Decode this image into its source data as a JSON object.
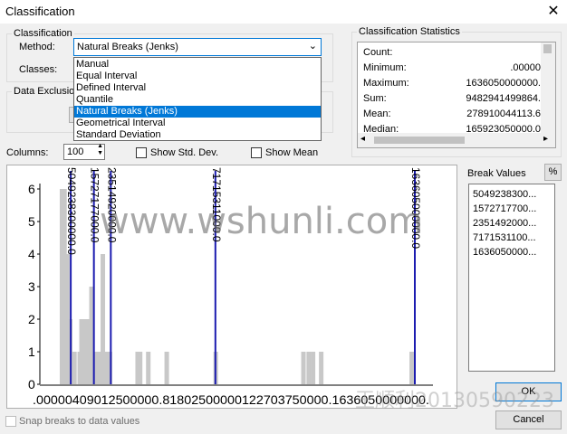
{
  "window": {
    "title": "Classification"
  },
  "classification": {
    "group_label": "Classification",
    "method_label": "Method:",
    "method_value": "Natural Breaks (Jenks)",
    "classes_label": "Classes:"
  },
  "method_options": [
    "Manual",
    "Equal Interval",
    "Defined Interval",
    "Quantile",
    "Natural Breaks (Jenks)",
    "Geometrical Interval",
    "Standard Deviation"
  ],
  "data_exclusion": {
    "label": "Data Exclusion"
  },
  "stats": {
    "title": "Classification Statistics",
    "rows": [
      {
        "label": "Count:",
        "value": ""
      },
      {
        "label": "Minimum:",
        "value": ".00000"
      },
      {
        "label": "Maximum:",
        "value": "1636050000000."
      },
      {
        "label": "Sum:",
        "value": "9482941499864."
      },
      {
        "label": "Mean:",
        "value": "278910044113.6"
      },
      {
        "label": "Median:",
        "value": "165923050000.0"
      }
    ]
  },
  "columns": {
    "label": "Columns:",
    "value": "100"
  },
  "show_std_dev": {
    "label": "Show Std. Dev.",
    "checked": false
  },
  "show_mean": {
    "label": "Show Mean",
    "checked": false
  },
  "chart_data": {
    "type": "bar",
    "title": "",
    "ylim": [
      0,
      6
    ],
    "y_ticks": [
      "6",
      "5",
      "4",
      "3",
      "2",
      "1",
      "0"
    ],
    "x_tick_text": ".00000409012500000.81802500000122703750000.1636050000000.",
    "break_lines": [
      "5049238300000.0",
      "15727177000.0",
      "23514920000.0",
      "71715311000.0",
      "163605000000.0"
    ],
    "break_fractions": [
      0.0309,
      0.0961,
      0.1437,
      0.4383,
      1.0
    ],
    "bars": [
      {
        "x": 0.005,
        "h": 6
      },
      {
        "x": 0.012,
        "h": 6
      },
      {
        "x": 0.02,
        "h": 4
      },
      {
        "x": 0.028,
        "h": 2
      },
      {
        "x": 0.04,
        "h": 1
      },
      {
        "x": 0.055,
        "h": 1
      },
      {
        "x": 0.06,
        "h": 2
      },
      {
        "x": 0.066,
        "h": 2
      },
      {
        "x": 0.072,
        "h": 2
      },
      {
        "x": 0.08,
        "h": 2
      },
      {
        "x": 0.088,
        "h": 3
      },
      {
        "x": 0.1,
        "h": 1
      },
      {
        "x": 0.112,
        "h": 1
      },
      {
        "x": 0.12,
        "h": 4
      },
      {
        "x": 0.132,
        "h": 1
      },
      {
        "x": 0.14,
        "h": 1
      },
      {
        "x": 0.218,
        "h": 1
      },
      {
        "x": 0.225,
        "h": 1
      },
      {
        "x": 0.248,
        "h": 1
      },
      {
        "x": 0.3,
        "h": 1
      },
      {
        "x": 0.438,
        "h": 1
      },
      {
        "x": 0.685,
        "h": 1
      },
      {
        "x": 0.7,
        "h": 1
      },
      {
        "x": 0.712,
        "h": 1
      },
      {
        "x": 0.735,
        "h": 1
      },
      {
        "x": 0.99,
        "h": 1
      }
    ]
  },
  "break_values": {
    "label": "Break Values",
    "percent_button": "%",
    "items": [
      "5049238300...",
      "1572717700...",
      "2351492000...",
      "7171531100...",
      "1636050000..."
    ]
  },
  "buttons": {
    "ok": "OK",
    "cancel": "Cancel"
  },
  "snap": {
    "label": "Snap breaks to data values",
    "checked": false
  },
  "watermarks": {
    "main": "www.wshunli.com",
    "corner": "王顺利20130590223"
  }
}
